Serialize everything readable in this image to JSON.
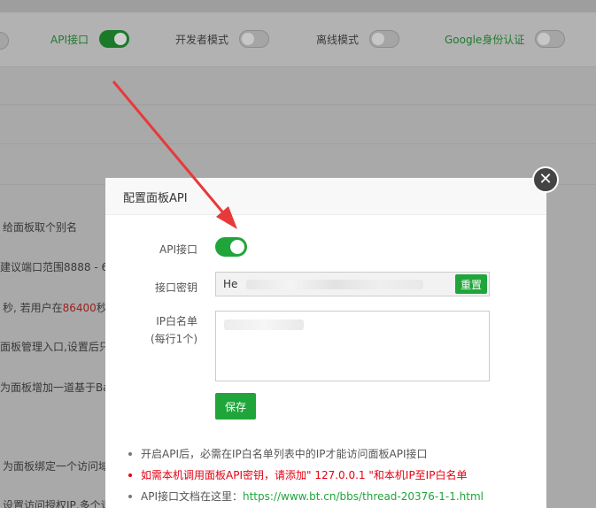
{
  "background": {
    "toggles": [
      {
        "label": "API接口",
        "state": "on"
      },
      {
        "label": "开发者模式",
        "state": "off"
      },
      {
        "label": "离线模式",
        "state": "off"
      },
      {
        "label": "Google身份认证",
        "state": "off"
      }
    ],
    "rows": [
      {
        "text": "给面板取个别名"
      },
      {
        "text": "建议端口范围8888 - 6"
      },
      {
        "text_before": "秒, 若用户在",
        "highlight": "86400",
        "text_after": "秒"
      },
      {
        "text": "面板管理入口,设置后只"
      },
      {
        "text": "为面板增加一道基于Ba"
      },
      {
        "text": "为面板绑定一个访问域"
      },
      {
        "text": "设置访问授权IP,多个请"
      }
    ]
  },
  "modal": {
    "title": "配置面板API",
    "close_icon": "close-icon",
    "api_label": "API接口",
    "api_state": "on",
    "key_label": "接口密钥",
    "key_value_visible": "He",
    "reset_label": "重置",
    "ip_label_line1": "IP白名单",
    "ip_label_line2": "(每行1个)",
    "save_label": "保存",
    "notes": [
      {
        "text": "开启API后，必需在IP白名单列表中的IP才能访问面板API接口",
        "style": "normal"
      },
      {
        "text": "如需本机调用面板API密钥，请添加\" 127.0.0.1 \"和本机IP至IP白名单",
        "style": "red"
      },
      {
        "text_before": "API接口文档在这里：",
        "link": "https://www.bt.cn/bbs/thread-20376-1-1.html",
        "style": "normal"
      }
    ]
  },
  "colors": {
    "accent": "#20a53a",
    "warning": "#e60012",
    "arrow": "#e8393a"
  }
}
